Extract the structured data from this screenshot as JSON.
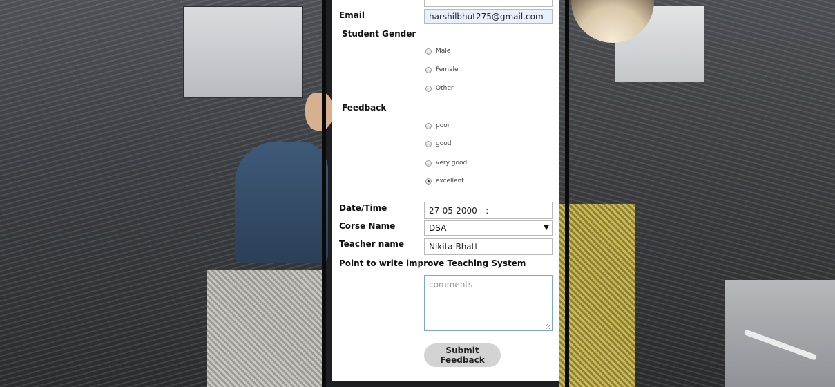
{
  "form": {
    "email_label": "Email",
    "email_value": "harshilbhut275@gmail.com",
    "gender_label": "Student Gender",
    "gender_options": [
      "Male",
      "Female",
      "Other"
    ],
    "feedback_label": "Feedback",
    "feedback_options": [
      "poor",
      "good",
      "very good",
      "excellent"
    ],
    "feedback_selected": "excellent",
    "datetime_label": "Date/Time",
    "datetime_value": "27-05-2000 --:-- --",
    "course_label": "Corse Name",
    "course_value": "DSA",
    "teacher_label": "Teacher name",
    "teacher_value": "Nikita Bhatt",
    "improve_label": "Point to write improve Teaching System",
    "comments_placeholder": "comments",
    "submit_label": "Submit Feedback"
  },
  "icons": {
    "select_arrow": "chevron-down-icon"
  },
  "colors": {
    "autofill": "#e8f0fe",
    "button": "#d3d3d3",
    "focus_border": "#7aa7d8"
  }
}
